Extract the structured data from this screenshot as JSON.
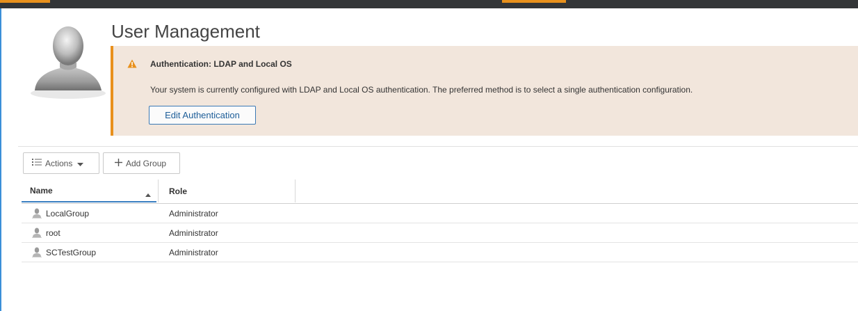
{
  "colors": {
    "accent_orange": "#e8901c",
    "top_bar": "#333537",
    "alert_bg": "#f2e6dc",
    "link_blue": "#1c5d98",
    "left_rule": "#3a8fd8"
  },
  "page": {
    "title": "User Management"
  },
  "alert": {
    "icon": "warning-icon",
    "title": "Authentication: LDAP and Local OS",
    "message": "Your system is currently configured with LDAP and Local OS authentication. The preferred method is to select a single authentication configuration.",
    "button_label": "Edit Authentication"
  },
  "toolbar": {
    "actions_label": "Actions",
    "add_group_label": "Add Group"
  },
  "table": {
    "columns": [
      "Name",
      "Role"
    ],
    "sort": {
      "column": "Name",
      "direction": "ascending"
    },
    "rows": [
      {
        "name": "LocalGroup",
        "role": "Administrator",
        "icon": "user-icon"
      },
      {
        "name": "root",
        "role": "Administrator",
        "icon": "user-icon"
      },
      {
        "name": "SCTestGroup",
        "role": "Administrator",
        "icon": "user-icon"
      }
    ]
  }
}
